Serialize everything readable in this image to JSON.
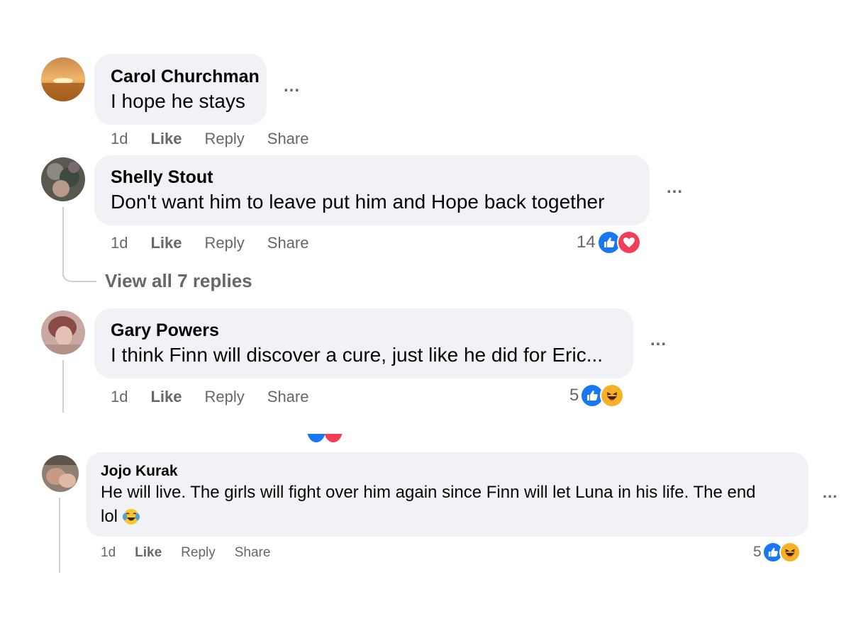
{
  "comments": [
    {
      "author": "Carol Churchman",
      "text": "I hope he stays",
      "time": "1d",
      "actions": {
        "like": "Like",
        "reply": "Reply",
        "share": "Share"
      },
      "more": "...",
      "avatar_icon": "sunset-photo-avatar",
      "colors": {
        "sky": "#e8a65c",
        "sun": "#fff3c2",
        "ground": "#9a5a1e"
      }
    },
    {
      "author": "Shelly Stout",
      "text": "Don't want him to leave put him and Hope back together",
      "time": "1d",
      "actions": {
        "like": "Like",
        "reply": "Reply",
        "share": "Share"
      },
      "more": "...",
      "reaction_count": "14",
      "reaction_icons": [
        "like-icon",
        "love-icon"
      ],
      "view_replies": "View all 7 replies",
      "avatar_icon": "person-photo-avatar"
    },
    {
      "author": "Gary Powers",
      "text": "I think Finn will discover a cure, just like he did for Eric...",
      "time": "1d",
      "actions": {
        "like": "Like",
        "reply": "Reply",
        "share": "Share"
      },
      "more": "...",
      "reaction_count": "5",
      "reaction_icons": [
        "like-icon",
        "haha-icon"
      ],
      "avatar_icon": "person-photo-avatar"
    },
    {
      "author": "Jojo Kurak",
      "text_line1": "He will live. The girls will fight over him again since Finn will let Luna in his life. The end",
      "text_line2": "lol",
      "emoji": "😂",
      "time": "1d",
      "actions": {
        "like": "Like",
        "reply": "Reply",
        "share": "Share"
      },
      "more": "...",
      "reaction_count": "5",
      "reaction_icons": [
        "like-icon",
        "haha-icon"
      ],
      "avatar_icon": "person-photo-avatar"
    }
  ],
  "colors": {
    "bubble": "#f0f2f5",
    "secondary_text": "#65676b",
    "like_blue": "#1877f2",
    "love_red": "#f33e58",
    "haha_yellow": "#f7b125"
  }
}
